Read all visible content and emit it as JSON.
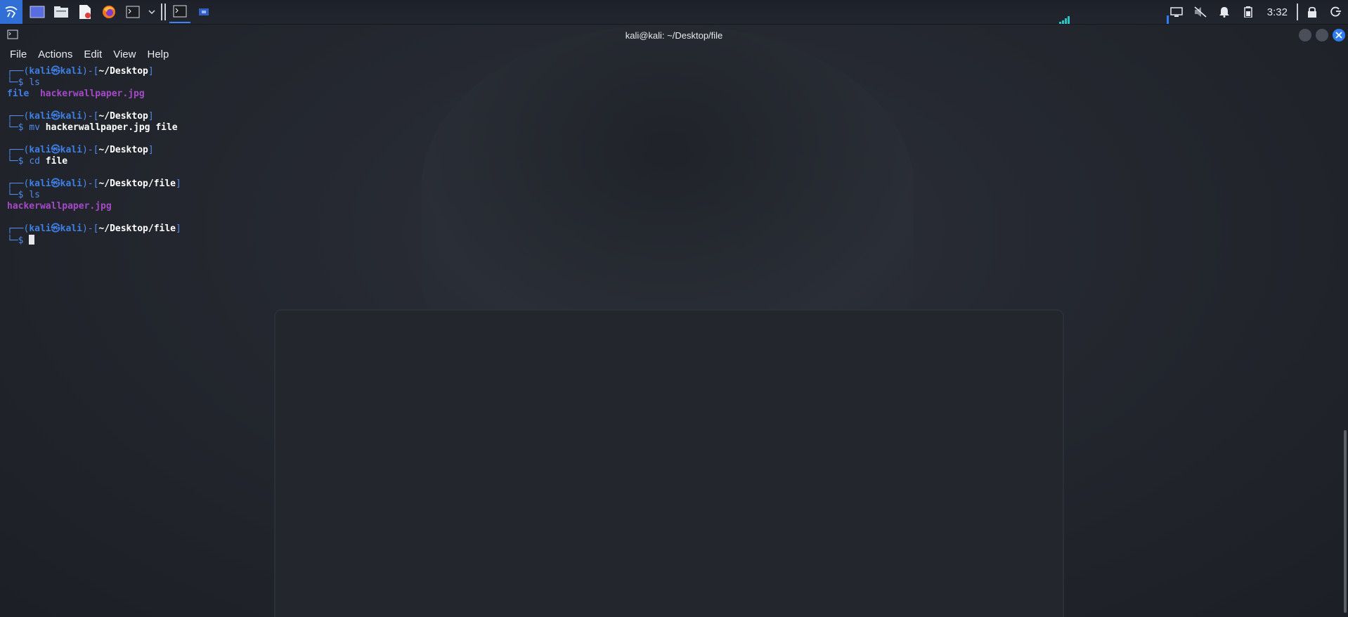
{
  "taskbar": {
    "icons": [
      "kali-menu-icon",
      "show-desktop-icon",
      "file-manager-icon",
      "text-editor-icon",
      "firefox-icon",
      "terminal-icon",
      "chevron-down-icon"
    ],
    "tasks": [
      "terminal-task-icon",
      "workspace-task-icon"
    ],
    "tray": [
      "display-icon",
      "volume-muted-icon",
      "bell-icon",
      "battery-icon"
    ],
    "clock": "3:32",
    "tray_right": [
      "lock-icon",
      "power-icon"
    ]
  },
  "window": {
    "title": "kali@kali: ~/Desktop/file"
  },
  "menu": [
    "File",
    "Actions",
    "Edit",
    "View",
    "Help"
  ],
  "terminal": {
    "frame_top": "┌──(",
    "frame_mid": ")-[",
    "frame_end": "]",
    "frame_bottom": "└─$",
    "user": "kali",
    "at": "㉿",
    "host": "kali",
    "blocks": [
      {
        "path": "~/Desktop",
        "cmd": "ls",
        "args": "",
        "output": [
          {
            "text": "file",
            "kind": "dir"
          },
          {
            "text": "hackerwallpaper.jpg",
            "kind": "img"
          }
        ]
      },
      {
        "path": "~/Desktop",
        "cmd": "mv",
        "args": "hackerwallpaper.jpg file",
        "output": []
      },
      {
        "path": "~/Desktop",
        "cmd": "cd",
        "args": "file",
        "output": []
      },
      {
        "path": "~/Desktop/file",
        "cmd": "ls",
        "args": "",
        "output": [
          {
            "text": "hackerwallpaper.jpg",
            "kind": "img"
          }
        ]
      },
      {
        "path": "~/Desktop/file",
        "cmd": "",
        "args": "",
        "output": [],
        "cursor": true
      }
    ]
  },
  "colors": {
    "accent": "#3e7fe6",
    "image_file": "#a44ac7",
    "background": "#1f2229"
  }
}
